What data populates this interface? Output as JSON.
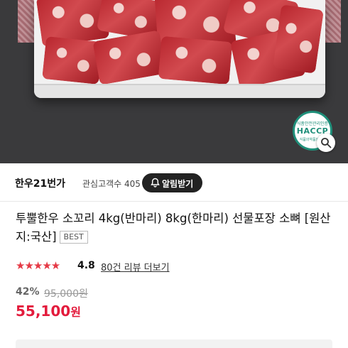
{
  "badge": {
    "top": "식품안전관리인증",
    "brand": "HACCP",
    "bottom": "식품의약품안전처"
  },
  "seller": {
    "name": "한우21번가",
    "interest_label": "관심고객수",
    "interest_count": "405",
    "alarm_label": "알림받기"
  },
  "product": {
    "title": "투뿔한우 소꼬리 4kg(반마리) 8kg(한마리) 선물포장 소뼈 [원산지:국산]",
    "badge": "BEST",
    "stars": "★★★★★",
    "rating": "4.8",
    "reviews": "80건 리뷰 더보기",
    "discount": "42%",
    "original_price": "95,000원",
    "price": "55,100",
    "currency": "원"
  },
  "colors": {
    "accent": "#e31b3c",
    "star": "#e53945",
    "dark_button": "#222222"
  },
  "icons": [
    "bell-icon",
    "zoom-icon"
  ]
}
